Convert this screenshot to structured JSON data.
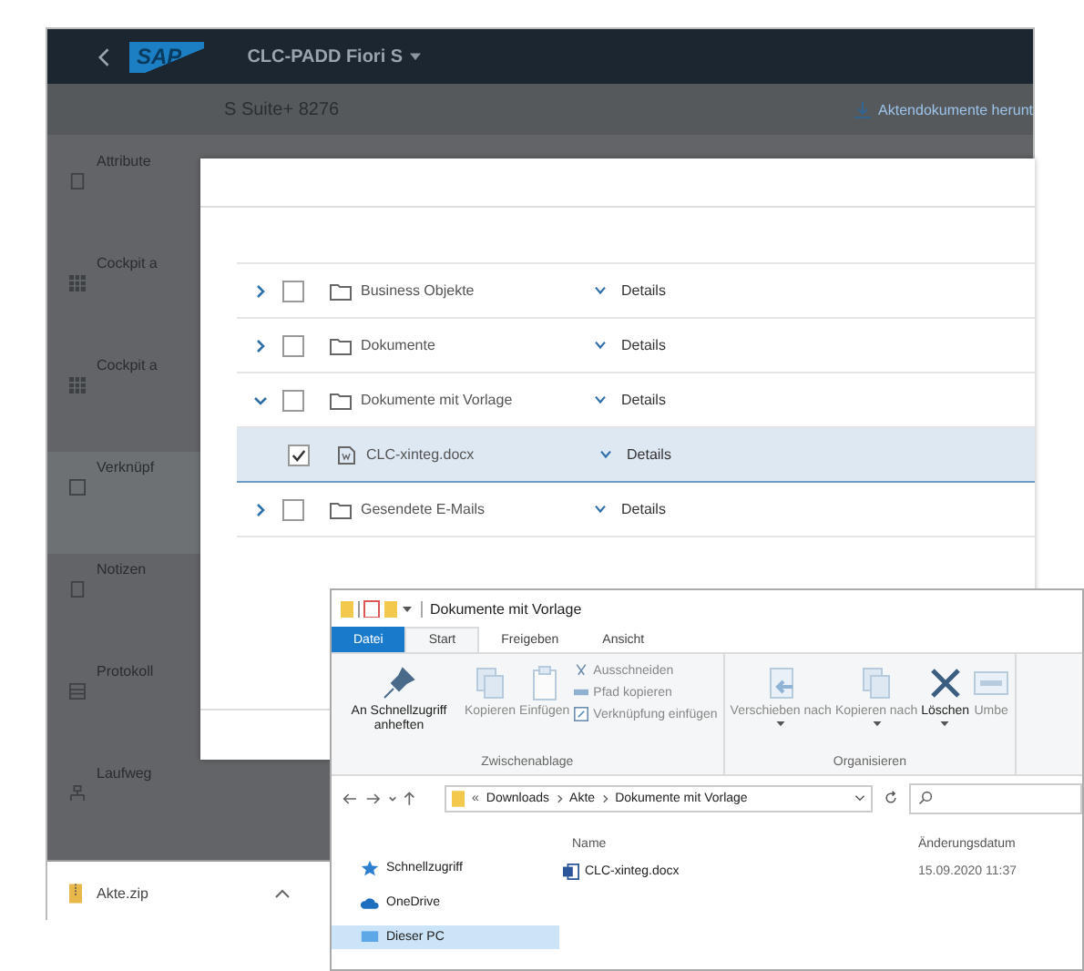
{
  "sap": {
    "logo": "SAP",
    "app_title": "CLC-PADD Fiori S",
    "subtitle": "S Suite+ 8276",
    "download_link": "Aktendokumente herunt",
    "sidebar": [
      {
        "kind": "document",
        "label": "Attribute",
        "selected": false
      },
      {
        "kind": "grid",
        "label": "Cockpit a",
        "selected": false
      },
      {
        "kind": "grid",
        "label": "Cockpit a",
        "selected": false
      },
      {
        "kind": "square",
        "label": "Verknüpf",
        "selected": true
      },
      {
        "kind": "document",
        "label": "Notizen",
        "selected": false
      },
      {
        "kind": "list",
        "label": "Protokoll",
        "selected": false
      },
      {
        "kind": "route",
        "label": "Laufweg",
        "selected": false
      }
    ],
    "download_bar": {
      "file": "Akte.zip"
    }
  },
  "dialog": {
    "tree": [
      {
        "kind": "folder",
        "label": "Business Objekte",
        "expanded": false,
        "checked": false,
        "selected": false,
        "details": "Details"
      },
      {
        "kind": "folder",
        "label": "Dokumente",
        "expanded": false,
        "checked": false,
        "selected": false,
        "details": "Details"
      },
      {
        "kind": "folder",
        "label": "Dokumente mit Vorlage",
        "expanded": true,
        "checked": false,
        "selected": false,
        "details": "Details",
        "children": [
          {
            "kind": "file",
            "label": "CLC-xinteg.docx",
            "checked": true,
            "selected": true,
            "details": "Details"
          }
        ]
      },
      {
        "kind": "folder",
        "label": "Gesendete E-Mails",
        "expanded": false,
        "checked": false,
        "selected": false,
        "details": "Details"
      }
    ]
  },
  "explorer": {
    "title": "Dokumente mit Vorlage",
    "tabs": [
      {
        "kind": "file",
        "label": "Datei",
        "selected": false
      },
      {
        "kind": "tab",
        "label": "Start",
        "selected": true
      },
      {
        "kind": "tab",
        "label": "Freigeben",
        "selected": false
      },
      {
        "kind": "tab",
        "label": "Ansicht",
        "selected": false
      }
    ],
    "ribbon_groups": [
      {
        "label": "Zwischenablage",
        "large": [
          {
            "kind": "pin",
            "label": "An Schnellzugriff anheften",
            "disabled": false,
            "dropdown": false
          },
          {
            "kind": "copy",
            "label": "Kopieren",
            "disabled": true,
            "dropdown": false
          },
          {
            "kind": "paste",
            "label": "Einfügen",
            "disabled": true,
            "dropdown": false
          }
        ],
        "small": [
          {
            "kind": "cut",
            "label": "Ausschneiden",
            "disabled": true
          },
          {
            "kind": "path",
            "label": "Pfad kopieren",
            "disabled": true
          },
          {
            "kind": "shortcut",
            "label": "Verknüpfung einfügen",
            "disabled": true
          }
        ]
      },
      {
        "label": "Organisieren",
        "large": [
          {
            "kind": "move",
            "label": "Verschieben nach",
            "disabled": true,
            "dropdown": true
          },
          {
            "kind": "copy",
            "label": "Kopieren nach",
            "disabled": true,
            "dropdown": true
          },
          {
            "kind": "delete",
            "label": "Löschen",
            "disabled": false,
            "dropdown": true
          },
          {
            "kind": "rename",
            "label": "Umbe",
            "disabled": true,
            "dropdown": false
          }
        ]
      }
    ],
    "address": {
      "overflow_mark": "«",
      "path": [
        "Downloads",
        "Akte",
        "Dokumente mit Vorlage"
      ]
    },
    "nav": [
      {
        "kind": "star",
        "label": "Schnellzugriff",
        "selected": false
      },
      {
        "kind": "cloud",
        "label": "OneDrive",
        "selected": false
      },
      {
        "kind": "pc",
        "label": "Dieser PC",
        "selected": true
      }
    ],
    "columns": [
      "Name",
      "Änderungsdatum"
    ],
    "files": [
      {
        "name": "CLC-xinteg.docx",
        "date": "15.09.2020 11:37"
      }
    ]
  }
}
